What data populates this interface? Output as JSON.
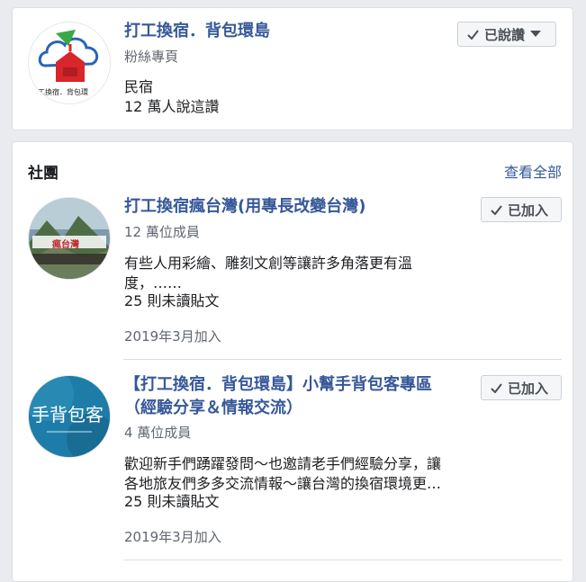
{
  "page_card": {
    "title": "打工換宿．背包環島",
    "subtitle": "粉絲專頁",
    "category": "民宿",
    "likes": "12 萬人說這讚",
    "like_button": "已說讚",
    "logo_caption": "工換宿．背包環"
  },
  "groups": {
    "header": "社團",
    "see_all": "查看全部",
    "items": [
      {
        "title": "打工換宿瘋台灣(用專長改變台灣)",
        "members": "12 萬位成員",
        "description_line1": "有些人用彩繪、雕刻文創等讓許多角落更有溫",
        "description_line2": "度，……",
        "unread": "25 則未讀貼文",
        "joined": "2019年3月加入",
        "button": "已加入",
        "avatar_text": "瘋台灣"
      },
      {
        "title_line1": "【打工換宿．背包環島】小幫手背包客專區",
        "title_line2": "（經驗分享＆情報交流）",
        "members": "4 萬位成員",
        "description_line1": "歡迎新手們踴躍發問～也邀請老手們經驗分享，讓",
        "description_line2": "各地旅友們多多交流情報～讓台灣的換宿環境更…",
        "unread": "25 則未讀貼文",
        "joined": "2019年3月加入",
        "button": "已加入",
        "avatar_text": "手背包客"
      }
    ]
  },
  "colors": {
    "link": "#365899",
    "background": "#e9ebee",
    "muted": "#606770"
  }
}
